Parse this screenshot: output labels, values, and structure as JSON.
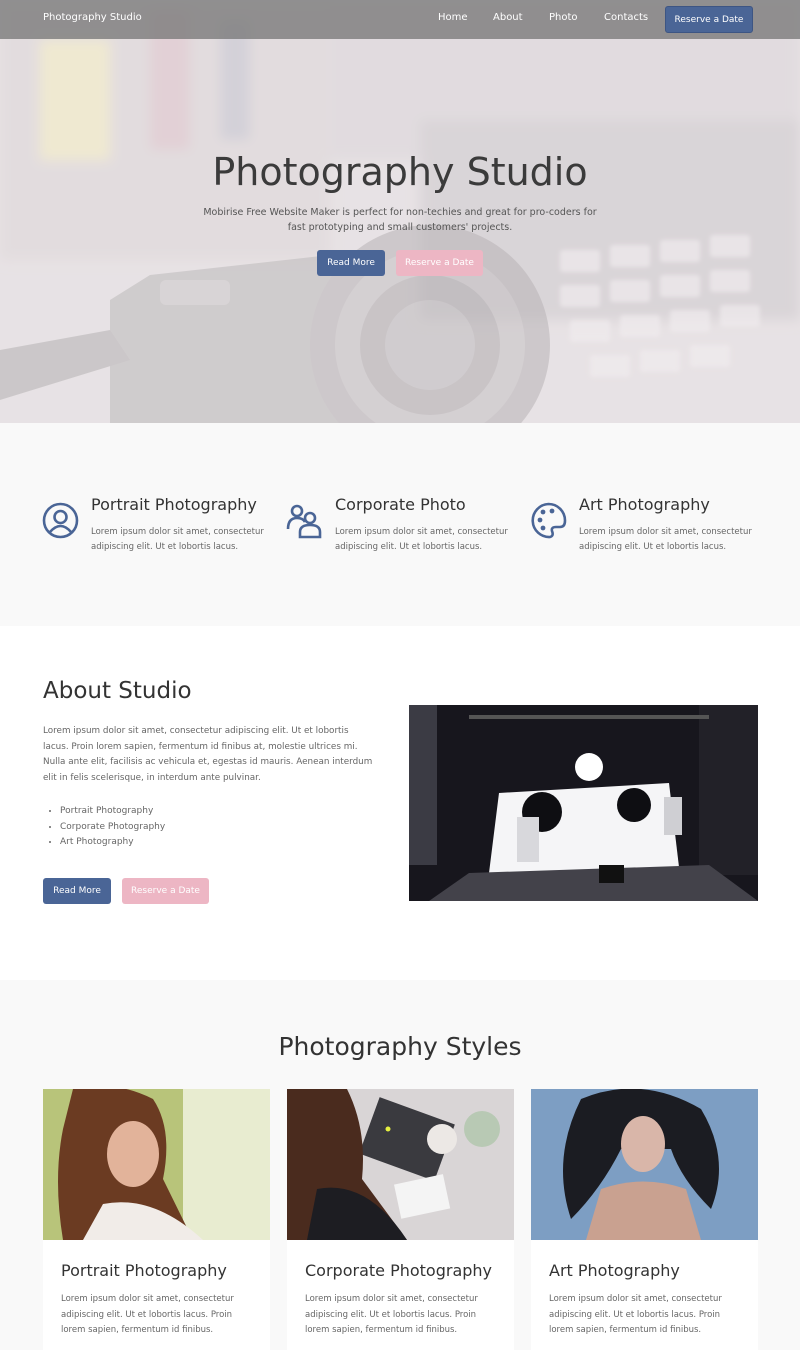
{
  "nav": {
    "brand": "Photography Studio",
    "links": [
      "Home",
      "About",
      "Photo",
      "Contacts"
    ],
    "cta": "Reserve a Date"
  },
  "hero": {
    "title": "Photography Studio",
    "subtitle": "Mobirise Free Website Maker is perfect for non-techies and great for pro-coders for fast prototyping and small customers' projects.",
    "primary_button": "Read More",
    "secondary_button": "Reserve a Date"
  },
  "features": [
    {
      "title": "Portrait Photography",
      "text": "Lorem ipsum dolor sit amet, consectetur adipiscing elit. Ut et lobortis lacus.",
      "icon": "user-circle-icon"
    },
    {
      "title": "Corporate Photo",
      "text": "Lorem ipsum dolor sit amet, consectetur adipiscing elit. Ut et lobortis lacus.",
      "icon": "users-icon"
    },
    {
      "title": "Art Photography",
      "text": "Lorem ipsum dolor sit amet, consectetur adipiscing elit. Ut et lobortis lacus.",
      "icon": "palette-icon"
    }
  ],
  "about": {
    "title": "About Studio",
    "text": "Lorem ipsum dolor sit amet, consectetur adipiscing elit. Ut et lobortis lacus. Proin lorem sapien, fermentum id finibus at, molestie ultrices mi. Nulla ante elit, facilisis ac vehicula et, egestas id mauris. Aenean interdum elit in felis scelerisque, in interdum ante pulvinar.",
    "list": [
      "Portrait Photography",
      "Corporate Photography",
      "Art Photography"
    ],
    "primary_button": "Read More",
    "secondary_button": "Reserve a Date"
  },
  "styles": {
    "title": "Photography Styles",
    "cards": [
      {
        "title": "Portrait Photography",
        "text": "Lorem ipsum dolor sit amet, consectetur adipiscing elit. Ut et lobortis lacus. Proin lorem sapien, fermentum id finibus."
      },
      {
        "title": "Corporate Photography",
        "text": "Lorem ipsum dolor sit amet, consectetur adipiscing elit. Ut et lobortis lacus. Proin lorem sapien, fermentum id finibus."
      },
      {
        "title": "Art Photography",
        "text": "Lorem ipsum dolor sit amet, consectetur adipiscing elit. Ut et lobortis lacus. Proin lorem sapien, fermentum id finibus."
      }
    ]
  },
  "colors": {
    "accent": "#4a6596",
    "secondary": "#edb6c4",
    "section_bg": "#f9f9f9"
  }
}
